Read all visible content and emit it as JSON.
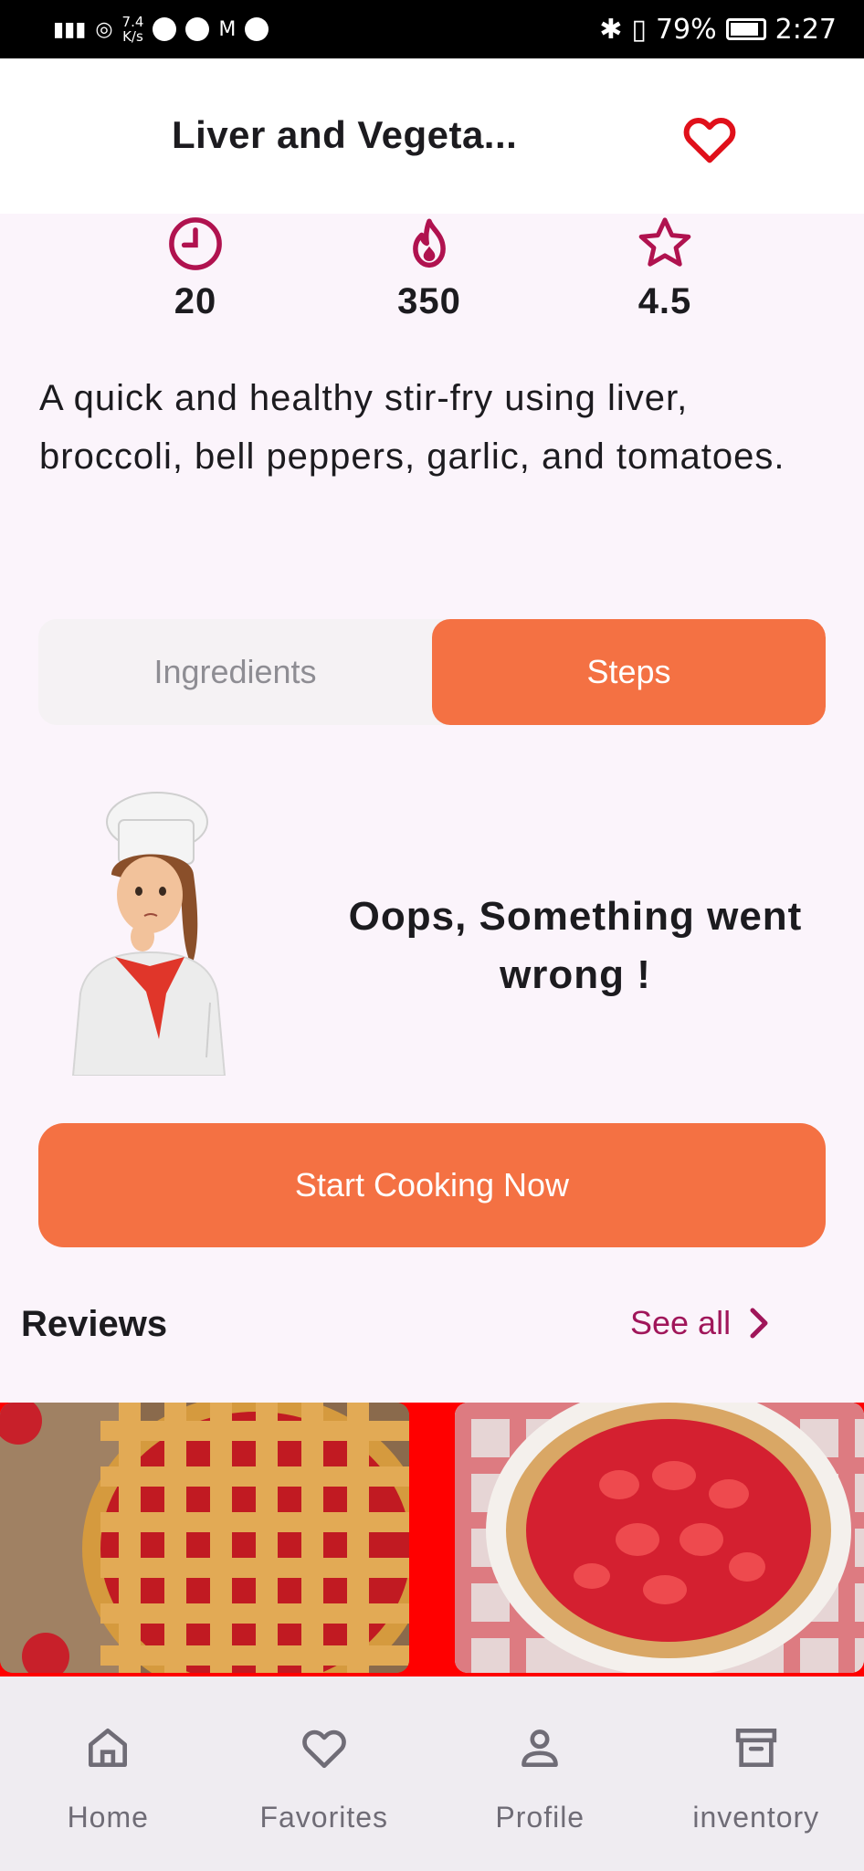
{
  "status_bar": {
    "network_speed": "7.4",
    "network_unit": "K/s",
    "battery": "79%",
    "time": "2:27"
  },
  "app_bar": {
    "title": "Liver and Vegeta..."
  },
  "stats": {
    "time": "20",
    "calories": "350",
    "rating": "4.5"
  },
  "description": "A quick and healthy stir-fry using liver, broccoli, bell peppers, garlic, and tomatoes.",
  "tabs": [
    {
      "label": "Ingredients",
      "selected": false
    },
    {
      "label": "Steps",
      "selected": true
    }
  ],
  "error": {
    "message": "Oops, Something went wrong !"
  },
  "start_button": "Start Cooking Now",
  "reviews": {
    "title": "Reviews",
    "see_all": "See all"
  },
  "bottom_nav": [
    {
      "label": "Home",
      "icon": "home-icon"
    },
    {
      "label": "Favorites",
      "icon": "heart-icon"
    },
    {
      "label": "Profile",
      "icon": "person-icon"
    },
    {
      "label": "inventory",
      "icon": "archive-icon"
    }
  ],
  "colors": {
    "accent": "#f47143",
    "icon_accent": "#b0124f",
    "favorite": "#e0101a",
    "background": "#fbf4fb"
  }
}
